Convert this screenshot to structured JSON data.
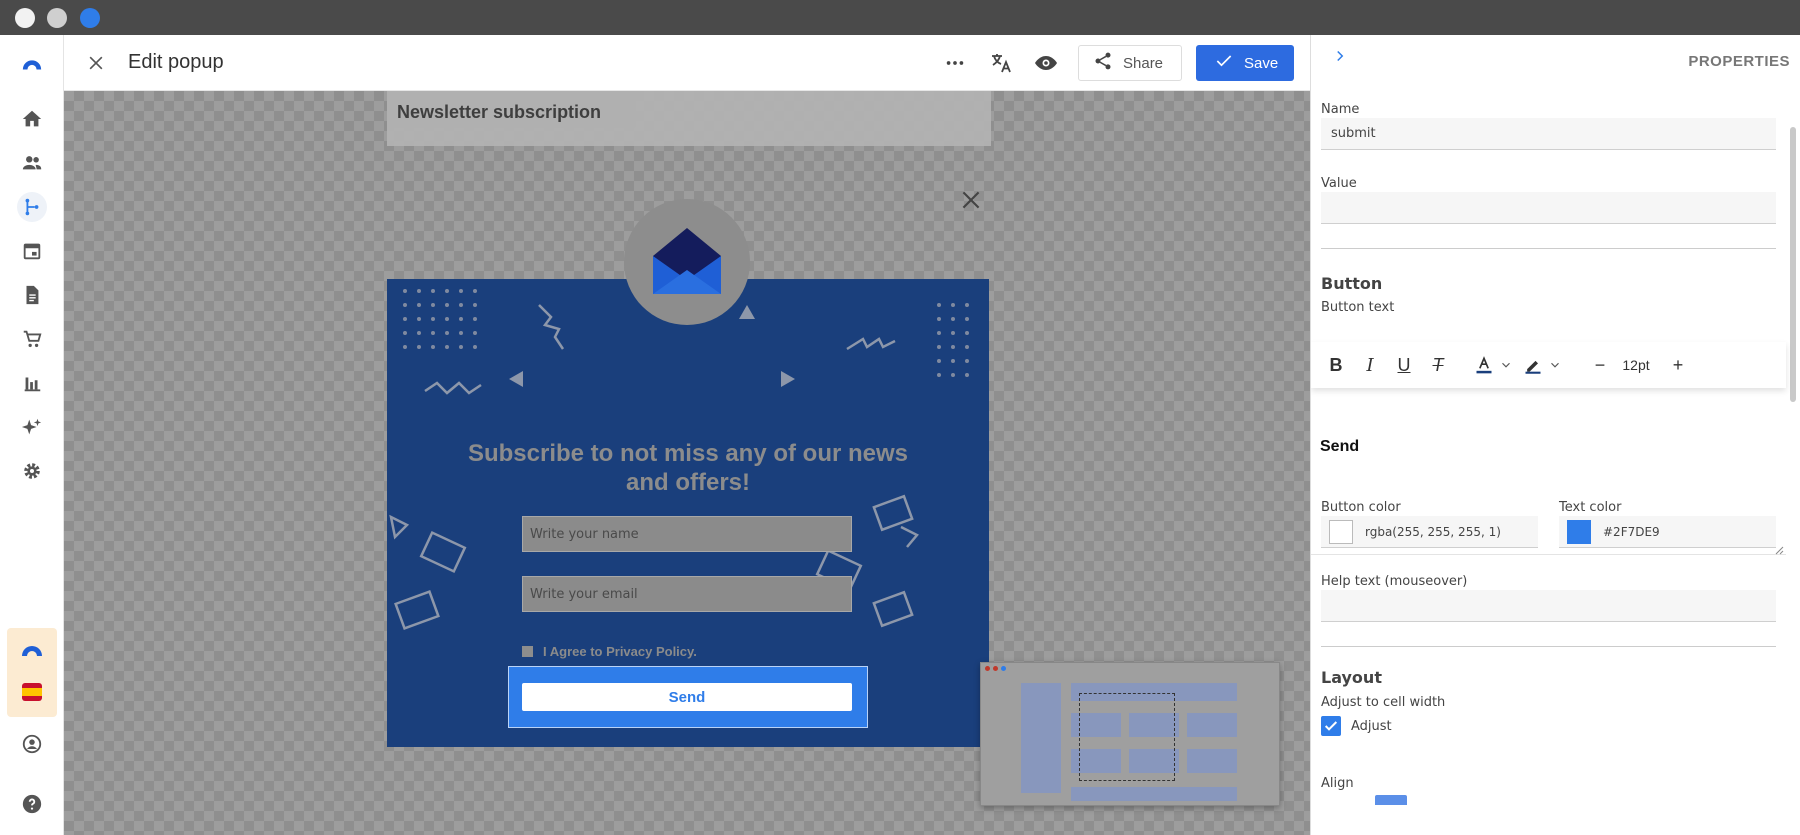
{
  "colors": {
    "accent": "#2d6be0",
    "popup_bg": "#1a3f7c",
    "send_bg": "#2f7de9",
    "text_color": "#2F7DE9"
  },
  "editor": {
    "title": "Edit popup",
    "share_label": "Share",
    "save_label": "Save",
    "icons": [
      "close-icon",
      "more-icon",
      "translate-icon",
      "preview-eye-icon",
      "share-icon",
      "check-icon"
    ]
  },
  "sidebar": {
    "items": [
      {
        "icon": "logo-icon"
      },
      {
        "icon": "home-icon"
      },
      {
        "icon": "contacts-icon"
      },
      {
        "icon": "automation-icon",
        "active": true
      },
      {
        "icon": "calendar-icon"
      },
      {
        "icon": "document-icon"
      },
      {
        "icon": "cart-icon"
      },
      {
        "icon": "bar-chart-icon"
      },
      {
        "icon": "sparkle-icon"
      },
      {
        "icon": "gear-icon"
      },
      {
        "icon": "account-icon"
      },
      {
        "icon": "help-icon"
      }
    ]
  },
  "canvas": {
    "doc_title": "Newsletter subscription",
    "headline": "Subscribe to not miss any of our news and offers!",
    "name_placeholder": "Write your name",
    "email_placeholder": "Write your email",
    "agree_label": "I Agree to Privacy Policy.",
    "send_label": "Send"
  },
  "properties": {
    "header": "PROPERTIES",
    "name_label": "Name",
    "name_value": "submit",
    "value_label": "Value",
    "value_value": "",
    "button_section": "Button",
    "button_text_label": "Button text",
    "font_size": "12pt",
    "button_text_value": "Send",
    "button_color_label": "Button color",
    "button_color_value": "rgba(255, 255, 255, 1)",
    "text_color_label": "Text color",
    "text_color_value": "#2F7DE9",
    "help_label": "Help text (mouseover)",
    "help_value": "",
    "layout_section": "Layout",
    "adjust_label": "Adjust to cell width",
    "adjust_checkbox": "Adjust",
    "align_label": "Align"
  }
}
